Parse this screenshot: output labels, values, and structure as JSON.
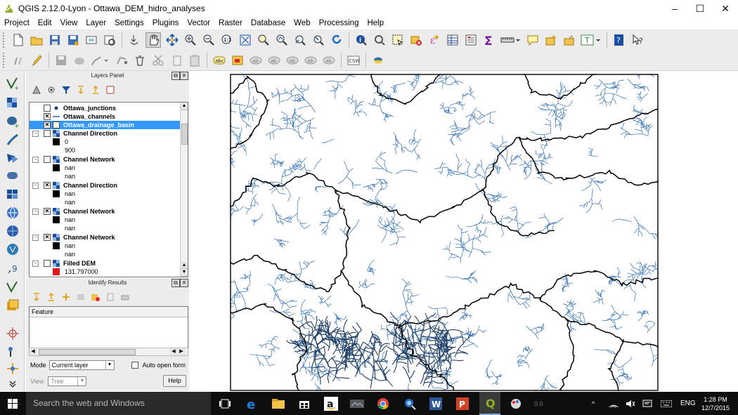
{
  "window": {
    "title": "QGIS 2.12.0-Lyon - Ottawa_DEM_hidro_analyses",
    "controls": {
      "minimize": "–",
      "maximize": "☐",
      "close": "✕"
    }
  },
  "menu": [
    "Project",
    "Edit",
    "View",
    "Layer",
    "Settings",
    "Plugins",
    "Vector",
    "Raster",
    "Database",
    "Web",
    "Processing",
    "Help"
  ],
  "layers_panel": {
    "title": "Layers Panel",
    "layers": [
      {
        "name": "Ottawa_junctions",
        "checked": false,
        "symbol": "point"
      },
      {
        "name": "Ottawa_channels",
        "checked": true,
        "symbol": "line"
      },
      {
        "name": "Ottawa_drainage_basin",
        "checked": true,
        "symbol": "polygon",
        "selected": true
      },
      {
        "name": "Channel Direction",
        "checked": false,
        "symbol": "raster",
        "legend": [
          "0",
          "900"
        ]
      },
      {
        "name": "Channel Network",
        "checked": false,
        "symbol": "raster",
        "legend": [
          "nan",
          "nan"
        ]
      },
      {
        "name": "Channel Direction",
        "checked": true,
        "symbol": "raster",
        "legend": [
          "nan",
          "nan"
        ]
      },
      {
        "name": "Channel Network",
        "checked": true,
        "symbol": "raster",
        "legend": [
          "nan",
          "nan"
        ]
      },
      {
        "name": "Channel Network",
        "checked": true,
        "symbol": "raster",
        "legend": [
          "nan",
          "nan"
        ]
      },
      {
        "name": "Filled DEM",
        "checked": false,
        "symbol": "raster",
        "legend": [
          "131.797000"
        ],
        "legend_color": "#e8141c"
      }
    ]
  },
  "identify_panel": {
    "title": "Identify Results",
    "column_header": "Feature",
    "mode_label": "Mode",
    "mode_value": "Current layer",
    "auto_open_label": "Auto open form",
    "view_label": "View",
    "view_value": "Tree",
    "help_label": "Help"
  },
  "taskbar": {
    "search_placeholder": "Search the web and Windows",
    "language": "ENG",
    "time": "1:28 PM",
    "date": "12/7/2015",
    "status_partial": [
      "0.0"
    ]
  },
  "colors": {
    "toolbar_bg": "#ececec",
    "selection": "#3399ff",
    "stream_blue": "#2d6fb5",
    "basin_boundary": "#000000",
    "taskbar_bg": "#0e0e0e"
  }
}
